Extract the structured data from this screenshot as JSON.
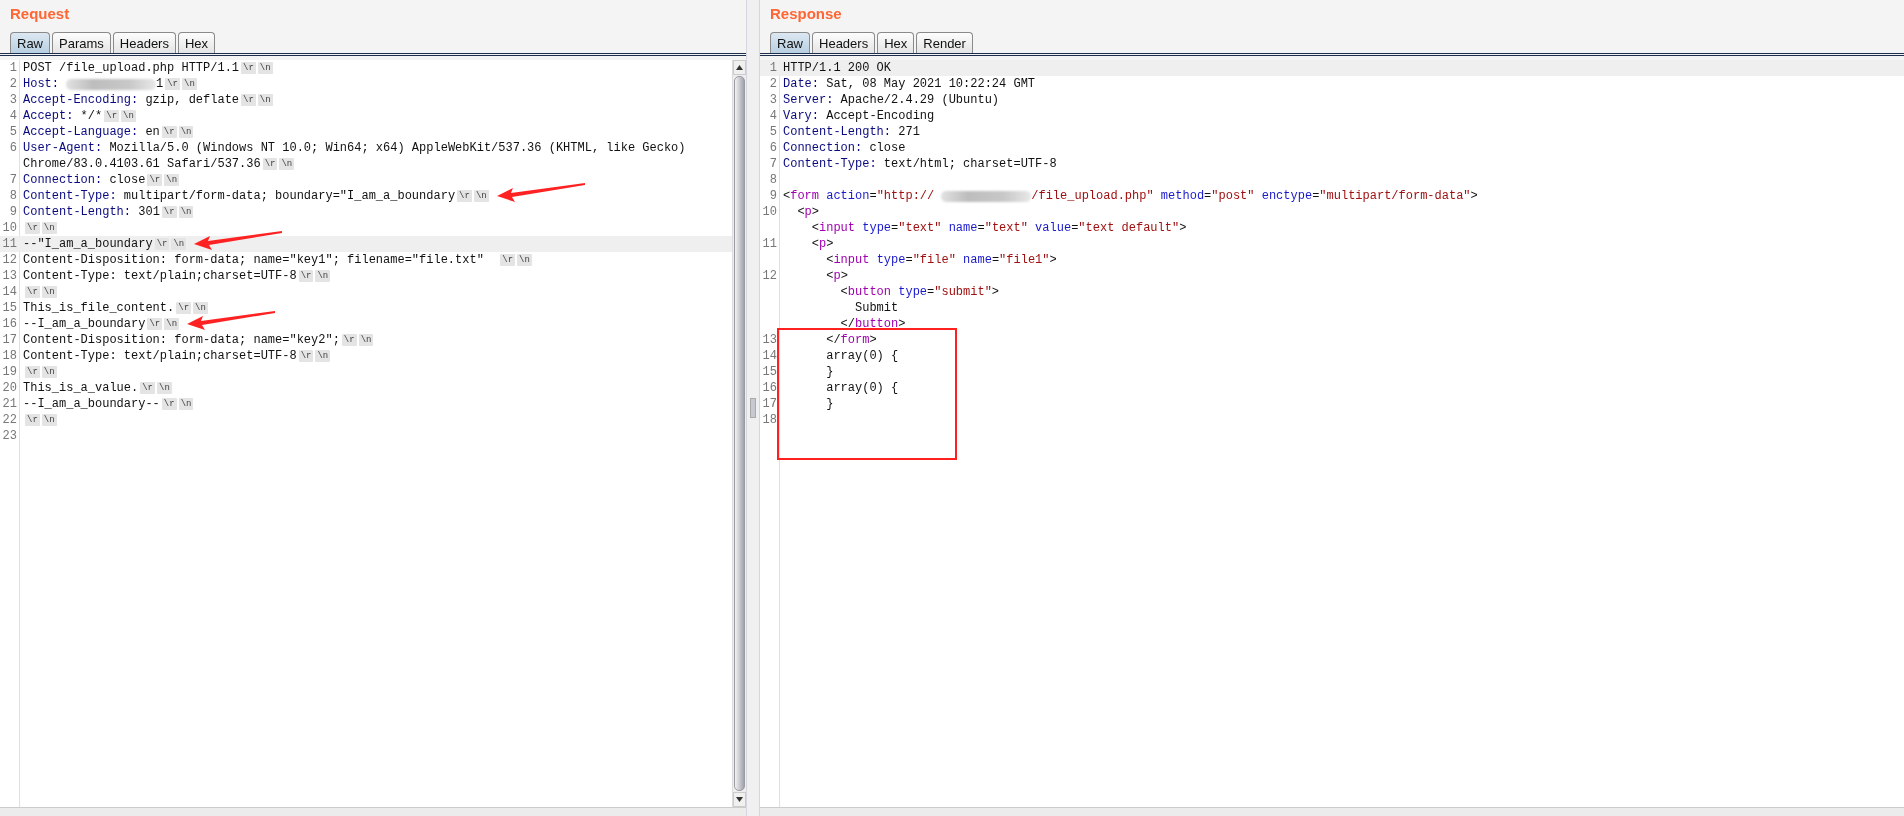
{
  "panels": [
    {
      "title": "Request",
      "scrollbar": true,
      "tabs": [
        {
          "label": "Raw",
          "selected": true
        },
        {
          "label": "Params",
          "selected": false
        },
        {
          "label": "Headers",
          "selected": false
        },
        {
          "label": "Hex",
          "selected": false
        }
      ],
      "lines": [
        {
          "number": "1",
          "highlighted": false,
          "annotated": false,
          "boxed": false,
          "rows": [
            {
              "tokens": [
                {
                  "kind": "plain",
                  "text": "POST /file_upload.php HTTP/1.1"
                },
                {
                  "kind": "crlf",
                  "text": "\\r"
                },
                {
                  "kind": "crlf",
                  "text": "\\n"
                }
              ]
            }
          ]
        },
        {
          "number": "2",
          "highlighted": false,
          "annotated": false,
          "boxed": false,
          "rows": [
            {
              "tokens": [
                {
                  "kind": "name",
                  "text": "Host:"
                },
                {
                  "kind": "redacted"
                },
                {
                  "kind": "plain",
                  "text": "1"
                },
                {
                  "kind": "crlf",
                  "text": "\\r"
                },
                {
                  "kind": "crlf",
                  "text": "\\n"
                }
              ]
            }
          ]
        },
        {
          "number": "3",
          "highlighted": false,
          "annotated": false,
          "boxed": false,
          "rows": [
            {
              "tokens": [
                {
                  "kind": "name",
                  "text": "Accept-Encoding:"
                },
                {
                  "kind": "plain",
                  "text": " gzip, deflate"
                },
                {
                  "kind": "crlf",
                  "text": "\\r"
                },
                {
                  "kind": "crlf",
                  "text": "\\n"
                }
              ]
            }
          ]
        },
        {
          "number": "4",
          "highlighted": false,
          "annotated": false,
          "boxed": false,
          "rows": [
            {
              "tokens": [
                {
                  "kind": "name",
                  "text": "Accept:"
                },
                {
                  "kind": "plain",
                  "text": " */*"
                },
                {
                  "kind": "crlf",
                  "text": "\\r"
                },
                {
                  "kind": "crlf",
                  "text": "\\n"
                }
              ]
            }
          ]
        },
        {
          "number": "5",
          "highlighted": false,
          "annotated": false,
          "boxed": false,
          "rows": [
            {
              "tokens": [
                {
                  "kind": "name",
                  "text": "Accept-Language:"
                },
                {
                  "kind": "plain",
                  "text": " en"
                },
                {
                  "kind": "crlf",
                  "text": "\\r"
                },
                {
                  "kind": "crlf",
                  "text": "\\n"
                }
              ]
            }
          ]
        },
        {
          "number": "6",
          "highlighted": false,
          "annotated": false,
          "boxed": false,
          "rows": [
            {
              "tokens": [
                {
                  "kind": "name",
                  "text": "User-Agent:"
                },
                {
                  "kind": "plain",
                  "text": " Mozilla/5.0 (Windows NT 10.0; Win64; x64) AppleWebKit/537.36 (KHTML, like Gecko)"
                }
              ]
            },
            {
              "tokens": [
                {
                  "kind": "plain",
                  "text": "Chrome/83.0.4103.61 Safari/537.36"
                },
                {
                  "kind": "crlf",
                  "text": "\\r"
                },
                {
                  "kind": "crlf",
                  "text": "\\n"
                }
              ]
            }
          ]
        },
        {
          "number": "7",
          "highlighted": false,
          "annotated": false,
          "boxed": false,
          "rows": [
            {
              "tokens": [
                {
                  "kind": "name",
                  "text": "Connection:"
                },
                {
                  "kind": "plain",
                  "text": " close"
                },
                {
                  "kind": "crlf",
                  "text": "\\r"
                },
                {
                  "kind": "crlf",
                  "text": "\\n"
                }
              ]
            }
          ]
        },
        {
          "number": "8",
          "highlighted": false,
          "annotated": true,
          "boxed": false,
          "rows": [
            {
              "tokens": [
                {
                  "kind": "name",
                  "text": "Content-Type:"
                },
                {
                  "kind": "plain",
                  "text": " multipart/form-data; boundary=\"I_am_a_boundary"
                },
                {
                  "kind": "crlf",
                  "text": "\\r"
                },
                {
                  "kind": "crlf",
                  "text": "\\n"
                }
              ]
            }
          ]
        },
        {
          "number": "9",
          "highlighted": false,
          "annotated": false,
          "boxed": false,
          "rows": [
            {
              "tokens": [
                {
                  "kind": "name",
                  "text": "Content-Length:"
                },
                {
                  "kind": "plain",
                  "text": " 301"
                },
                {
                  "kind": "crlf",
                  "text": "\\r"
                },
                {
                  "kind": "crlf",
                  "text": "\\n"
                }
              ]
            }
          ]
        },
        {
          "number": "10",
          "highlighted": false,
          "annotated": false,
          "boxed": false,
          "rows": [
            {
              "tokens": [
                {
                  "kind": "crlf",
                  "text": "\\r"
                },
                {
                  "kind": "crlf",
                  "text": "\\n"
                }
              ]
            }
          ]
        },
        {
          "number": "11",
          "highlighted": true,
          "annotated": true,
          "boxed": false,
          "rows": [
            {
              "tokens": [
                {
                  "kind": "plain",
                  "text": "--\"I_am_a_boundary"
                },
                {
                  "kind": "crlf",
                  "text": "\\r"
                },
                {
                  "kind": "crlf",
                  "text": "\\n"
                }
              ]
            }
          ]
        },
        {
          "number": "12",
          "highlighted": false,
          "annotated": false,
          "boxed": false,
          "rows": [
            {
              "tokens": [
                {
                  "kind": "plain",
                  "text": "Content-Disposition: form-data; name=\"key1\"; filename=\"file.txt\"  "
                },
                {
                  "kind": "crlf",
                  "text": "\\r"
                },
                {
                  "kind": "crlf",
                  "text": "\\n"
                }
              ]
            }
          ]
        },
        {
          "number": "13",
          "highlighted": false,
          "annotated": false,
          "boxed": false,
          "rows": [
            {
              "tokens": [
                {
                  "kind": "plain",
                  "text": "Content-Type: text/plain;charset=UTF-8"
                },
                {
                  "kind": "crlf",
                  "text": "\\r"
                },
                {
                  "kind": "crlf",
                  "text": "\\n"
                }
              ]
            }
          ]
        },
        {
          "number": "14",
          "highlighted": false,
          "annotated": false,
          "boxed": false,
          "rows": [
            {
              "tokens": [
                {
                  "kind": "crlf",
                  "text": "\\r"
                },
                {
                  "kind": "crlf",
                  "text": "\\n"
                }
              ]
            }
          ]
        },
        {
          "number": "15",
          "highlighted": false,
          "annotated": false,
          "boxed": false,
          "rows": [
            {
              "tokens": [
                {
                  "kind": "plain",
                  "text": "This_is_file_content."
                },
                {
                  "kind": "crlf",
                  "text": "\\r"
                },
                {
                  "kind": "crlf",
                  "text": "\\n"
                }
              ]
            }
          ]
        },
        {
          "number": "16",
          "highlighted": false,
          "annotated": true,
          "boxed": false,
          "rows": [
            {
              "tokens": [
                {
                  "kind": "plain",
                  "text": "--I_am_a_boundary"
                },
                {
                  "kind": "crlf",
                  "text": "\\r"
                },
                {
                  "kind": "crlf",
                  "text": "\\n"
                }
              ]
            }
          ]
        },
        {
          "number": "17",
          "highlighted": false,
          "annotated": false,
          "boxed": false,
          "rows": [
            {
              "tokens": [
                {
                  "kind": "plain",
                  "text": "Content-Disposition: form-data; name=\"key2\";"
                },
                {
                  "kind": "crlf",
                  "text": "\\r"
                },
                {
                  "kind": "crlf",
                  "text": "\\n"
                }
              ]
            }
          ]
        },
        {
          "number": "18",
          "highlighted": false,
          "annotated": false,
          "boxed": false,
          "rows": [
            {
              "tokens": [
                {
                  "kind": "plain",
                  "text": "Content-Type: text/plain;charset=UTF-8"
                },
                {
                  "kind": "crlf",
                  "text": "\\r"
                },
                {
                  "kind": "crlf",
                  "text": "\\n"
                }
              ]
            }
          ]
        },
        {
          "number": "19",
          "highlighted": false,
          "annotated": false,
          "boxed": false,
          "rows": [
            {
              "tokens": [
                {
                  "kind": "crlf",
                  "text": "\\r"
                },
                {
                  "kind": "crlf",
                  "text": "\\n"
                }
              ]
            }
          ]
        },
        {
          "number": "20",
          "highlighted": false,
          "annotated": false,
          "boxed": false,
          "rows": [
            {
              "tokens": [
                {
                  "kind": "plain",
                  "text": "This_is_a_value."
                },
                {
                  "kind": "crlf",
                  "text": "\\r"
                },
                {
                  "kind": "crlf",
                  "text": "\\n"
                }
              ]
            }
          ]
        },
        {
          "number": "21",
          "highlighted": false,
          "annotated": false,
          "boxed": false,
          "rows": [
            {
              "tokens": [
                {
                  "kind": "plain",
                  "text": "--I_am_a_boundary--"
                },
                {
                  "kind": "crlf",
                  "text": "\\r"
                },
                {
                  "kind": "crlf",
                  "text": "\\n"
                }
              ]
            }
          ]
        },
        {
          "number": "22",
          "highlighted": false,
          "annotated": false,
          "boxed": false,
          "rows": [
            {
              "tokens": [
                {
                  "kind": "crlf",
                  "text": "\\r"
                },
                {
                  "kind": "crlf",
                  "text": "\\n"
                }
              ]
            }
          ]
        },
        {
          "number": "23",
          "highlighted": false,
          "annotated": false,
          "boxed": false,
          "rows": [
            {
              "tokens": []
            }
          ]
        }
      ]
    },
    {
      "title": "Response",
      "scrollbar": false,
      "tabs": [
        {
          "label": "Raw",
          "selected": true
        },
        {
          "label": "Headers",
          "selected": false
        },
        {
          "label": "Hex",
          "selected": false
        },
        {
          "label": "Render",
          "selected": false
        }
      ],
      "lines": [
        {
          "number": "1",
          "highlighted": true,
          "annotated": false,
          "boxed": false,
          "rows": [
            {
              "tokens": [
                {
                  "kind": "plain",
                  "text": "HTTP/1.1 200 OK"
                }
              ]
            }
          ]
        },
        {
          "number": "2",
          "highlighted": false,
          "annotated": false,
          "boxed": false,
          "rows": [
            {
              "tokens": [
                {
                  "kind": "name",
                  "text": "Date:"
                },
                {
                  "kind": "plain",
                  "text": " Sat, 08 May 2021 10:22:24 GMT"
                }
              ]
            }
          ]
        },
        {
          "number": "3",
          "highlighted": false,
          "annotated": false,
          "boxed": false,
          "rows": [
            {
              "tokens": [
                {
                  "kind": "name",
                  "text": "Server:"
                },
                {
                  "kind": "plain",
                  "text": " Apache/2.4.29 (Ubuntu)"
                }
              ]
            }
          ]
        },
        {
          "number": "4",
          "highlighted": false,
          "annotated": false,
          "boxed": false,
          "rows": [
            {
              "tokens": [
                {
                  "kind": "name",
                  "text": "Vary:"
                },
                {
                  "kind": "plain",
                  "text": " Accept-Encoding"
                }
              ]
            }
          ]
        },
        {
          "number": "5",
          "highlighted": false,
          "annotated": false,
          "boxed": false,
          "rows": [
            {
              "tokens": [
                {
                  "kind": "name",
                  "text": "Content-Length:"
                },
                {
                  "kind": "plain",
                  "text": " 271"
                }
              ]
            }
          ]
        },
        {
          "number": "6",
          "highlighted": false,
          "annotated": false,
          "boxed": false,
          "rows": [
            {
              "tokens": [
                {
                  "kind": "name",
                  "text": "Connection:"
                },
                {
                  "kind": "plain",
                  "text": " close"
                }
              ]
            }
          ]
        },
        {
          "number": "7",
          "highlighted": false,
          "annotated": false,
          "boxed": false,
          "rows": [
            {
              "tokens": [
                {
                  "kind": "name",
                  "text": "Content-Type:"
                },
                {
                  "kind": "plain",
                  "text": " text/html; charset=UTF-8"
                }
              ]
            }
          ]
        },
        {
          "number": "8",
          "highlighted": false,
          "annotated": false,
          "boxed": false,
          "rows": [
            {
              "tokens": []
            }
          ]
        },
        {
          "number": "9",
          "highlighted": false,
          "annotated": false,
          "boxed": false,
          "rows": [
            {
              "tokens": [
                {
                  "kind": "plain",
                  "text": "<"
                },
                {
                  "kind": "tag",
                  "text": "form"
                },
                {
                  "kind": "attr",
                  "text": " action"
                },
                {
                  "kind": "plain",
                  "text": "="
                },
                {
                  "kind": "value",
                  "text": "\"http://"
                },
                {
                  "kind": "redacted"
                },
                {
                  "kind": "value",
                  "text": "/file_upload.php\""
                },
                {
                  "kind": "attr",
                  "text": " method"
                },
                {
                  "kind": "plain",
                  "text": "="
                },
                {
                  "kind": "value",
                  "text": "\"post\""
                },
                {
                  "kind": "attr",
                  "text": " enctype"
                },
                {
                  "kind": "plain",
                  "text": "="
                },
                {
                  "kind": "value",
                  "text": "\"multipart/form-data\""
                },
                {
                  "kind": "plain",
                  "text": ">"
                }
              ]
            }
          ]
        },
        {
          "number": "10",
          "highlighted": false,
          "annotated": false,
          "boxed": false,
          "rows": [
            {
              "tokens": [
                {
                  "kind": "plain",
                  "text": "  <"
                },
                {
                  "kind": "tag",
                  "text": "p"
                },
                {
                  "kind": "plain",
                  "text": ">"
                }
              ]
            },
            {
              "tokens": [
                {
                  "kind": "plain",
                  "text": "    <"
                },
                {
                  "kind": "tag",
                  "text": "input"
                },
                {
                  "kind": "attr",
                  "text": " type"
                },
                {
                  "kind": "plain",
                  "text": "="
                },
                {
                  "kind": "value",
                  "text": "\"text\""
                },
                {
                  "kind": "attr",
                  "text": " name"
                },
                {
                  "kind": "plain",
                  "text": "="
                },
                {
                  "kind": "value",
                  "text": "\"text\""
                },
                {
                  "kind": "attr",
                  "text": " value"
                },
                {
                  "kind": "plain",
                  "text": "="
                },
                {
                  "kind": "value",
                  "text": "\"text default\""
                },
                {
                  "kind": "plain",
                  "text": ">"
                }
              ]
            }
          ]
        },
        {
          "number": "11",
          "highlighted": false,
          "annotated": false,
          "boxed": false,
          "rows": [
            {
              "tokens": [
                {
                  "kind": "plain",
                  "text": "    <"
                },
                {
                  "kind": "tag",
                  "text": "p"
                },
                {
                  "kind": "plain",
                  "text": ">"
                }
              ]
            },
            {
              "tokens": [
                {
                  "kind": "plain",
                  "text": "      <"
                },
                {
                  "kind": "tag",
                  "text": "input"
                },
                {
                  "kind": "attr",
                  "text": " type"
                },
                {
                  "kind": "plain",
                  "text": "="
                },
                {
                  "kind": "value",
                  "text": "\"file\""
                },
                {
                  "kind": "attr",
                  "text": " name"
                },
                {
                  "kind": "plain",
                  "text": "="
                },
                {
                  "kind": "value",
                  "text": "\"file1\""
                },
                {
                  "kind": "plain",
                  "text": ">"
                }
              ]
            }
          ]
        },
        {
          "number": "12",
          "highlighted": false,
          "annotated": false,
          "boxed": false,
          "rows": [
            {
              "tokens": [
                {
                  "kind": "plain",
                  "text": "      <"
                },
                {
                  "kind": "tag",
                  "text": "p"
                },
                {
                  "kind": "plain",
                  "text": ">"
                }
              ]
            },
            {
              "tokens": [
                {
                  "kind": "plain",
                  "text": "        <"
                },
                {
                  "kind": "tag",
                  "text": "button"
                },
                {
                  "kind": "attr",
                  "text": " type"
                },
                {
                  "kind": "plain",
                  "text": "="
                },
                {
                  "kind": "value",
                  "text": "\"submit\""
                },
                {
                  "kind": "plain",
                  "text": ">"
                }
              ]
            },
            {
              "tokens": [
                {
                  "kind": "plain",
                  "text": "          Submit"
                }
              ]
            },
            {
              "tokens": [
                {
                  "kind": "plain",
                  "text": "        </"
                },
                {
                  "kind": "tag",
                  "text": "button"
                },
                {
                  "kind": "plain",
                  "text": ">"
                }
              ]
            }
          ]
        },
        {
          "number": "13",
          "highlighted": false,
          "annotated": false,
          "boxed": true,
          "rows": [
            {
              "tokens": [
                {
                  "kind": "plain",
                  "text": "      </"
                },
                {
                  "kind": "tag",
                  "text": "form"
                },
                {
                  "kind": "plain",
                  "text": ">"
                }
              ]
            }
          ]
        },
        {
          "number": "14",
          "highlighted": false,
          "annotated": false,
          "boxed": true,
          "rows": [
            {
              "tokens": [
                {
                  "kind": "plain",
                  "text": "      array(0) {"
                }
              ]
            }
          ]
        },
        {
          "number": "15",
          "highlighted": false,
          "annotated": false,
          "boxed": true,
          "rows": [
            {
              "tokens": [
                {
                  "kind": "plain",
                  "text": "      }"
                }
              ]
            }
          ]
        },
        {
          "number": "16",
          "highlighted": false,
          "annotated": false,
          "boxed": true,
          "rows": [
            {
              "tokens": [
                {
                  "kind": "plain",
                  "text": "      array(0) {"
                }
              ]
            }
          ]
        },
        {
          "number": "17",
          "highlighted": false,
          "annotated": false,
          "boxed": true,
          "rows": [
            {
              "tokens": [
                {
                  "kind": "plain",
                  "text": "      }"
                }
              ]
            }
          ]
        },
        {
          "number": "18",
          "highlighted": false,
          "annotated": false,
          "boxed": true,
          "rows": [
            {
              "tokens": []
            }
          ]
        }
      ]
    }
  ]
}
